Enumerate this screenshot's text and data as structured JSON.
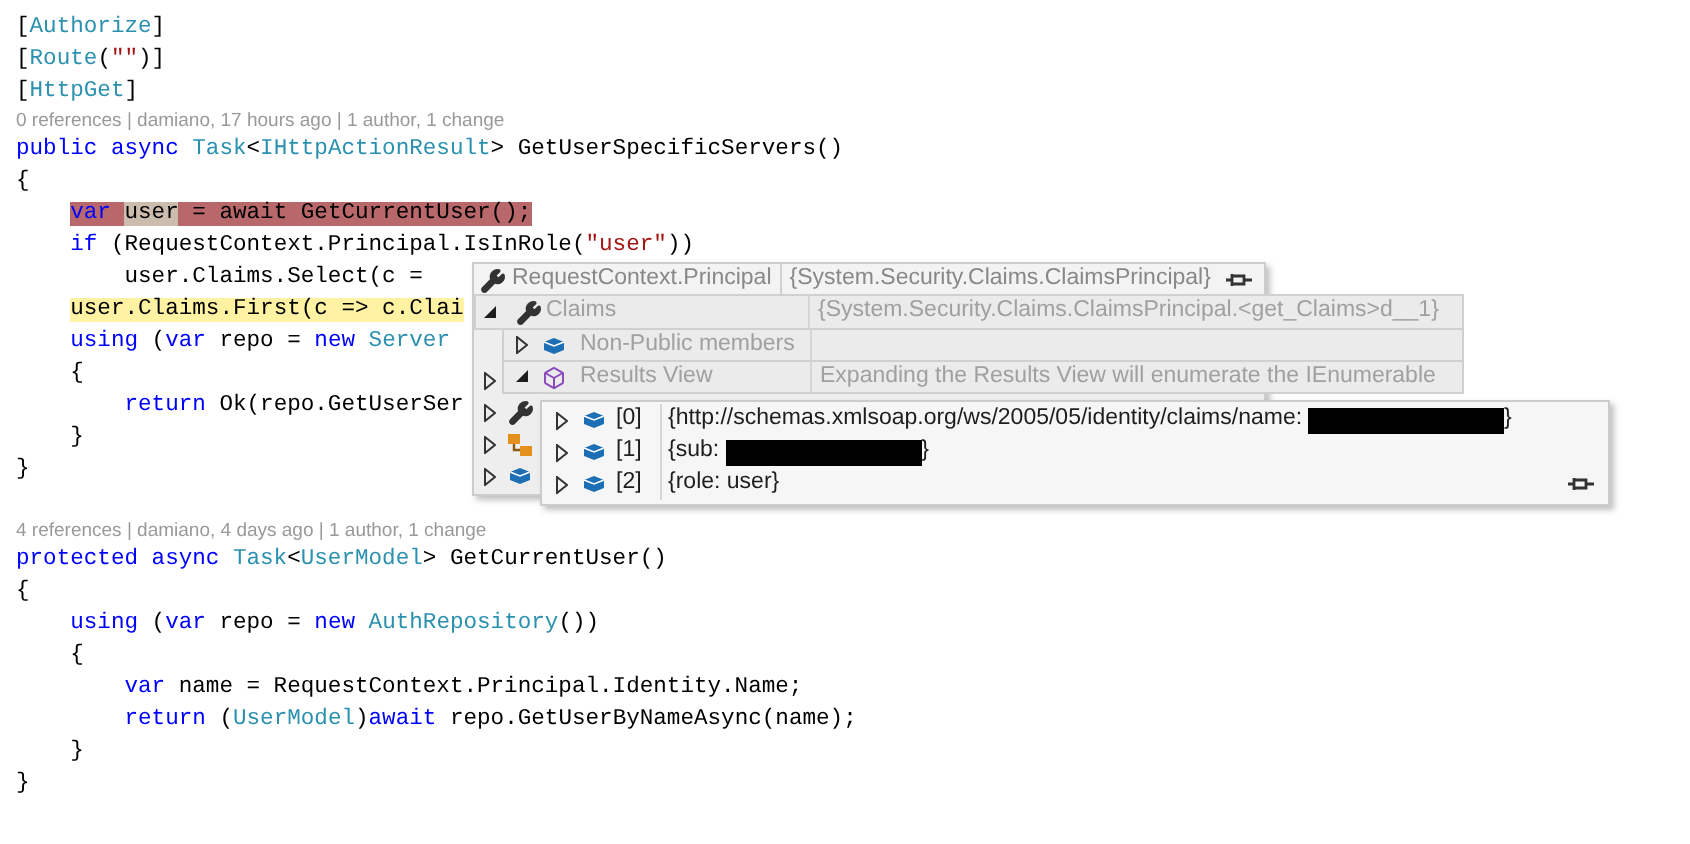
{
  "editor": {
    "lines": [
      {
        "kind": "code",
        "breakpoint": false,
        "current": false,
        "tokens": [
          {
            "kind": "plain",
            "text": "["
          },
          {
            "kind": "type",
            "text": "Authorize"
          },
          {
            "kind": "plain",
            "text": "]"
          }
        ]
      },
      {
        "kind": "code",
        "breakpoint": false,
        "current": false,
        "tokens": [
          {
            "kind": "plain",
            "text": "["
          },
          {
            "kind": "type",
            "text": "Route"
          },
          {
            "kind": "plain",
            "text": "("
          },
          {
            "kind": "string",
            "text": "\"\""
          },
          {
            "kind": "plain",
            "text": ")]"
          }
        ]
      },
      {
        "kind": "code",
        "breakpoint": false,
        "current": false,
        "tokens": [
          {
            "kind": "plain",
            "text": "["
          },
          {
            "kind": "type",
            "text": "HttpGet"
          },
          {
            "kind": "plain",
            "text": "]"
          }
        ]
      },
      {
        "kind": "lens",
        "text": "0 references | damiano, 17 hours ago | 1 author, 1 change"
      },
      {
        "kind": "code",
        "breakpoint": false,
        "current": false,
        "tokens": [
          {
            "kind": "keyword",
            "text": "public async "
          },
          {
            "kind": "type",
            "text": "Task"
          },
          {
            "kind": "plain",
            "text": "<"
          },
          {
            "kind": "type",
            "text": "IHttpActionResult"
          },
          {
            "kind": "plain",
            "text": "> GetUserSpecificServers()"
          }
        ]
      },
      {
        "kind": "code",
        "breakpoint": false,
        "current": false,
        "tokens": [
          {
            "kind": "plain",
            "text": "{"
          }
        ]
      },
      {
        "kind": "code",
        "breakpoint": true,
        "current": false,
        "tokens": [
          {
            "kind": "keyword",
            "text": "    var "
          },
          {
            "kind": "plain",
            "text": "user",
            "selected": true
          },
          {
            "kind": "plain",
            "text": " = await GetCurrentUser();"
          }
        ]
      },
      {
        "kind": "code",
        "breakpoint": false,
        "current": false,
        "tokens": [
          {
            "kind": "keyword",
            "text": "    if"
          },
          {
            "kind": "plain",
            "text": " (RequestContext.Principal.IsInRole("
          },
          {
            "kind": "string",
            "text": "\"user\""
          },
          {
            "kind": "plain",
            "text": "))"
          }
        ]
      },
      {
        "kind": "code",
        "breakpoint": false,
        "current": false,
        "tokens": [
          {
            "kind": "plain",
            "text": "        user.Claims.Select(c ="
          }
        ]
      },
      {
        "kind": "code",
        "breakpoint": false,
        "current": true,
        "tokens": [
          {
            "kind": "plain",
            "text": "    user.Claims.First(c => c.Clai"
          }
        ]
      },
      {
        "kind": "code",
        "breakpoint": false,
        "current": false,
        "tokens": [
          {
            "kind": "keyword",
            "text": "    using"
          },
          {
            "kind": "plain",
            "text": " ("
          },
          {
            "kind": "keyword",
            "text": "var"
          },
          {
            "kind": "plain",
            "text": " repo = "
          },
          {
            "kind": "keyword",
            "text": "new "
          },
          {
            "kind": "type",
            "text": "Server"
          }
        ]
      },
      {
        "kind": "code",
        "breakpoint": false,
        "current": false,
        "tokens": [
          {
            "kind": "plain",
            "text": "    {"
          }
        ]
      },
      {
        "kind": "code",
        "breakpoint": false,
        "current": false,
        "tokens": [
          {
            "kind": "keyword",
            "text": "        return"
          },
          {
            "kind": "plain",
            "text": " Ok(repo.GetUserSer"
          }
        ]
      },
      {
        "kind": "code",
        "breakpoint": false,
        "current": false,
        "tokens": [
          {
            "kind": "plain",
            "text": "    }"
          }
        ]
      },
      {
        "kind": "code",
        "breakpoint": false,
        "current": false,
        "tokens": [
          {
            "kind": "plain",
            "text": "}"
          }
        ]
      },
      {
        "kind": "blank"
      },
      {
        "kind": "lens",
        "text": "4 references | damiano, 4 days ago | 1 author, 1 change"
      },
      {
        "kind": "code",
        "breakpoint": false,
        "current": false,
        "tokens": [
          {
            "kind": "keyword",
            "text": "protected async "
          },
          {
            "kind": "type",
            "text": "Task"
          },
          {
            "kind": "plain",
            "text": "<"
          },
          {
            "kind": "type",
            "text": "UserModel"
          },
          {
            "kind": "plain",
            "text": "> GetCurrentUser()"
          }
        ]
      },
      {
        "kind": "code",
        "breakpoint": false,
        "current": false,
        "tokens": [
          {
            "kind": "plain",
            "text": "{"
          }
        ]
      },
      {
        "kind": "code",
        "breakpoint": false,
        "current": false,
        "tokens": [
          {
            "kind": "keyword",
            "text": "    using"
          },
          {
            "kind": "plain",
            "text": " ("
          },
          {
            "kind": "keyword",
            "text": "var"
          },
          {
            "kind": "plain",
            "text": " repo = "
          },
          {
            "kind": "keyword",
            "text": "new "
          },
          {
            "kind": "type",
            "text": "AuthRepository"
          },
          {
            "kind": "plain",
            "text": "())"
          }
        ]
      },
      {
        "kind": "code",
        "breakpoint": false,
        "current": false,
        "tokens": [
          {
            "kind": "plain",
            "text": "    {"
          }
        ]
      },
      {
        "kind": "code",
        "breakpoint": false,
        "current": false,
        "tokens": [
          {
            "kind": "keyword",
            "text": "        var"
          },
          {
            "kind": "plain",
            "text": " name = RequestContext.Principal.Identity.Name;"
          }
        ]
      },
      {
        "kind": "code",
        "breakpoint": false,
        "current": false,
        "tokens": [
          {
            "kind": "keyword",
            "text": "        return"
          },
          {
            "kind": "plain",
            "text": " ("
          },
          {
            "kind": "type",
            "text": "UserModel"
          },
          {
            "kind": "plain",
            "text": ")"
          },
          {
            "kind": "keyword",
            "text": "await"
          },
          {
            "kind": "plain",
            "text": " repo.GetUserByNameAsync(name);"
          }
        ]
      },
      {
        "kind": "code",
        "breakpoint": false,
        "current": false,
        "tokens": [
          {
            "kind": "plain",
            "text": "    }"
          }
        ]
      },
      {
        "kind": "code",
        "breakpoint": false,
        "current": false,
        "tokens": [
          {
            "kind": "plain",
            "text": "}"
          }
        ]
      }
    ]
  },
  "principal_tip": {
    "dimmed": true,
    "name": "RequestContext.Principal",
    "value": "{System.Security.Claims.ClaimsPrincipal}",
    "rows": [
      {
        "expanded": false
      },
      {
        "kind": "property",
        "expanded": false
      },
      {
        "kind": "class",
        "expanded": false
      },
      {
        "kind": "field",
        "expanded": false
      }
    ]
  },
  "claims_tip": {
    "dimmed": true,
    "name": "Claims",
    "kind": "property",
    "expanded": true,
    "value": "{System.Security.Claims.ClaimsPrincipal.<get_Claims>d__1}",
    "children": [
      {
        "name": "Non-Public members",
        "kind": "field",
        "expanded": false
      },
      {
        "name": "Results View",
        "kind": "results",
        "expanded": true,
        "value": "Expanding the Results View will enumerate the IEnumerable"
      }
    ]
  },
  "results_tip": {
    "dimmed": false,
    "items": [
      {
        "index": "[0]",
        "kind": "field",
        "expanded": false,
        "value": "{http://schemas.xmlsoap.org/ws/2005/05/identity/claims/name:",
        "redacted": true,
        "value_end": "}"
      },
      {
        "index": "[1]",
        "kind": "field",
        "expanded": false,
        "value": "{sub:",
        "redacted": true,
        "value_end": "}"
      },
      {
        "index": "[2]",
        "kind": "field",
        "expanded": false,
        "value": "{role: user}",
        "redacted": false
      }
    ]
  }
}
